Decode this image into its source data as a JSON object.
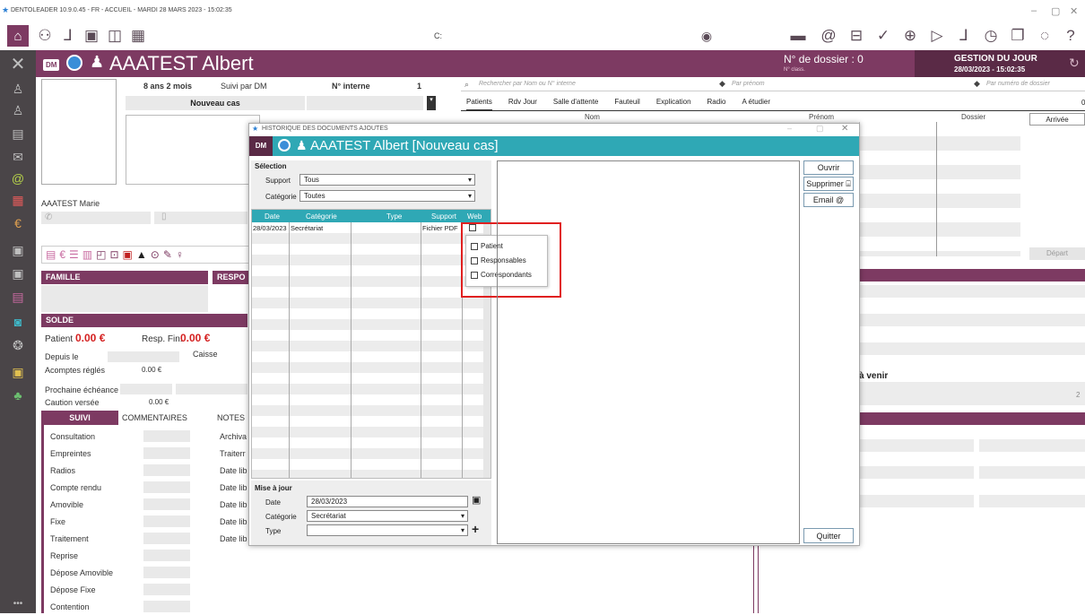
{
  "app": {
    "title": "DENTOLEADER 10.9.0.45 - FR - ACCUEIL - MARDI 28 MARS 2023 - 15:02:35",
    "path_label": "C:"
  },
  "toolbar_icons": [
    "home-icon",
    "user-icon",
    "chair-icon",
    "door-icon",
    "search-doc-icon",
    "calendar-icon"
  ],
  "toolbar_right_icons": [
    "card-icon",
    "at-icon",
    "inbox-icon",
    "check-icon",
    "zoom-icon",
    "play-icon",
    "chair2-icon",
    "clock-icon",
    "copy-icon",
    "chat-icon",
    "help-icon"
  ],
  "header": {
    "badge": "DM",
    "patient_name": "AAATEST Albert",
    "dossier": "N° de dossier : 0",
    "classe": "N° class.",
    "gestion_title": "GESTION DU JOUR",
    "gestion_date": "28/03/2023 - 15:02:35"
  },
  "patient": {
    "age": "8 ans 2 mois",
    "suivi": "Suivi par DM",
    "interne_label": "N° interne",
    "interne_value": "1",
    "case": "Nouveau cas",
    "contact": "AAATEST Marie"
  },
  "sections": {
    "famille": "FAMILLE",
    "resp": "RESPO",
    "solde": "SOLDE",
    "patient_label": "Patient",
    "patient_amount": "0.00 €",
    "resp_label": "Resp. Fin.",
    "resp_amount": "0.00 €",
    "caisse": "Caisse",
    "depuis": "Depuis le",
    "acomptes": "Acomptes réglés",
    "acomptes_value": "0.00 €",
    "echeance": "Prochaine échéance",
    "caution": "Caution versée",
    "caution_value": "0.00 €"
  },
  "tabs": [
    "SUIVI",
    "COMMENTAIRES",
    "NOTES"
  ],
  "suivi_rows": [
    "Consultation",
    "Empreintes",
    "Radios",
    "Compte rendu",
    "Amovible",
    "Fixe",
    "Traitement",
    "Reprise",
    "Dépose Amovible",
    "Dépose Fixe",
    "Contention"
  ],
  "suivi_right": [
    "Archiva",
    "Traiterr",
    "Date lib",
    "Date lib",
    "Date lib",
    "Date lib",
    "Date lib"
  ],
  "search": {
    "placeholder_main": "Rechercher par Nom ou N° interne",
    "placeholder_prenom": "Par prénom",
    "placeholder_dossier": "Par numéro de dossier"
  },
  "right_tabs": [
    "Patients",
    "Rdv Jour",
    "Salle d'attente",
    "Fauteuil",
    "Explication",
    "Radio",
    "A étudier"
  ],
  "right_cols": {
    "nom": "Nom",
    "prenom": "Prénom",
    "dossier": "Dossier",
    "arrivee": "Arrivée",
    "count": "0",
    "dossier_val": "0",
    "depart": "Départ",
    "a_venir": "à venir",
    "two": "2"
  },
  "dialog": {
    "title": "HISTORIQUE DES DOCUMENTS AJOUTES",
    "badge": "DM",
    "heading": "AAATEST Albert  [Nouveau cas]",
    "selection": "Sélection",
    "support_label": "Support",
    "support_value": "Tous",
    "categorie_label": "Catégorie",
    "categorie_value": "Toutes",
    "columns": [
      "Date",
      "Catégorie",
      "Type",
      "Support",
      "Web"
    ],
    "row": {
      "date": "28/03/2023",
      "categorie": "Secrétariat",
      "type": "",
      "support": "Fichier PDF"
    },
    "web_options": [
      "Patient",
      "Responsables",
      "Correspondants"
    ],
    "buttons": {
      "ouvrir": "Ouvrir",
      "supprimer": "Supprimer",
      "email": "Email",
      "quitter": "Quitter"
    },
    "maj": "Mise à jour",
    "date_label": "Date",
    "date_value": "28/03/2023",
    "cat_label": "Catégorie",
    "cat_value": "Secrétariat",
    "type_label": "Type",
    "type_value": ""
  },
  "colors": {
    "brand": "#7d3a62",
    "teal": "#2fa8b5",
    "sidebar": "#4a4548",
    "highlight": "#e02020"
  }
}
